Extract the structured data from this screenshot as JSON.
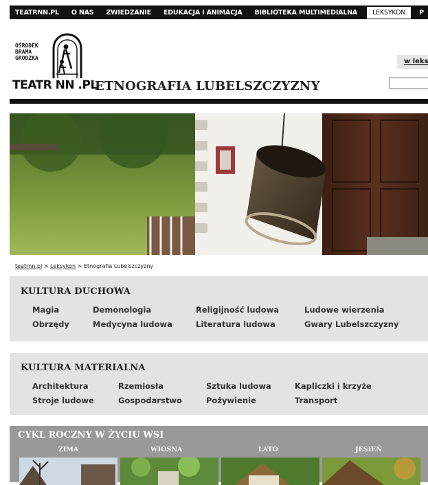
{
  "nav": {
    "items": [
      "TEATRNN.PL",
      "O NAS",
      "ZWIEDZANIE",
      "EDUKACJA I ANIMACJA",
      "BIBLIOTEKA MULTIMEDIALNA",
      "LEKSYKON",
      "P"
    ],
    "active": "LEKSYKON"
  },
  "header": {
    "logo_line1": "OŚRODEK",
    "logo_line2": "BRAMA",
    "logo_line3": "GRODZKA",
    "logo_name": "TEATR NN .PL",
    "site_title": "ETNOGRAFIA LUBELSZCZYZNY",
    "search_tab": "w leks"
  },
  "breadcrumb": {
    "home": "teatrnn.pl",
    "sep1": " > ",
    "section": "Leksykon",
    "sep2": " > ",
    "current": "Etnografia Lubelszczyzny"
  },
  "spiritual": {
    "title": "KULTURA DUCHOWA",
    "links": [
      "Magia",
      "Demonologia",
      "Religijność ludowa",
      "Ludowe wierzenia",
      "Obrzędy",
      "Medycyna ludowa",
      "Literatura ludowa",
      "Gwary Lubelszczyzny"
    ]
  },
  "material": {
    "title": "KULTURA MATERIALNA",
    "links": [
      "Architektura",
      "Rzemiosła",
      "Sztuka ludowa",
      "Kapliczki i krzyże",
      "Stroje ludowe",
      "Gospodarstwo",
      "Pożywienie",
      "Transport"
    ]
  },
  "cycle": {
    "title": "CYKL ROCZNY W ŻYCIU WSI",
    "seasons": [
      "ZIMA",
      "WIOSNA",
      "LATO",
      "JESIEŃ"
    ]
  },
  "colors": {
    "nav_bg": "#111111",
    "box_bg": "#e3e3e3",
    "cycle_bg": "#999999"
  }
}
